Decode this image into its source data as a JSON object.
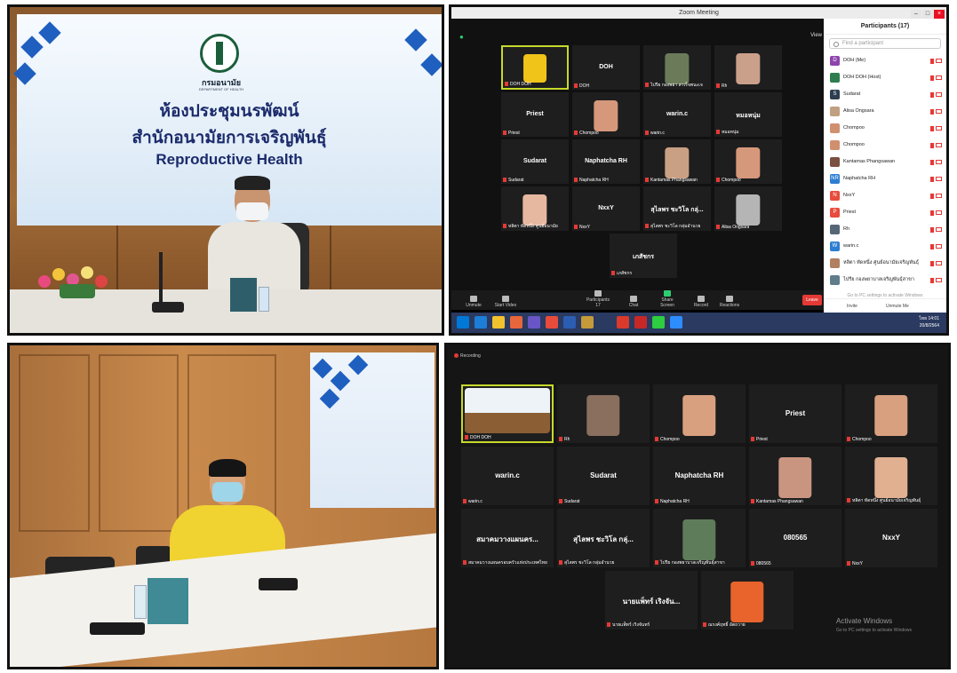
{
  "top_left": {
    "sign_dept": "กรมอนามัย",
    "sign_dept_en": "DEPARTMENT OF HEALTH",
    "sign_line1": "ห้องประชุมนรพัฒน์",
    "sign_line2": "สำนักอนามัยการเจริญพันธุ์",
    "sign_line3": "Reproductive Health"
  },
  "zoom_top": {
    "window_title": "Zoom Meeting",
    "view_label": "View",
    "participants_header": "Participants (17)",
    "find_placeholder": "Find a participant",
    "tiles": [
      {
        "name": "",
        "label": "DOH DOH"
      },
      {
        "name": "DOH",
        "label": "DOH"
      },
      {
        "name": "",
        "label": "ไปรีย กองพยา สาเร็จพนะเจ"
      },
      {
        "name": "",
        "label": "Rh"
      },
      {
        "name": "Priest",
        "label": "Priest"
      },
      {
        "name": "",
        "label": "Chompoo"
      },
      {
        "name": "warin.c",
        "label": "warin.c"
      },
      {
        "name": "หมอหนุ่ม",
        "label": "หมอหนุ่ม"
      },
      {
        "name": "Sudarat",
        "label": "Sudarat"
      },
      {
        "name": "Naphatcha RH",
        "label": "Naphatcha RH"
      },
      {
        "name": "",
        "label": "Kantamas Phangsawan"
      },
      {
        "name": "",
        "label": "Chompoo"
      },
      {
        "name": "",
        "label": "หลิตา ทัดหนึ่ง ศูนย์อนามัย"
      },
      {
        "name": "NxxY",
        "label": "NxxY"
      },
      {
        "name": "สุไลพร ชะวิโล กลุ่...",
        "label": "สุไลพร ชะวิโล กลุ่มอำนวย"
      },
      {
        "name": "",
        "label": "Alisa Ongsara"
      },
      {
        "name": "เภสัชกร",
        "label": "เภสัชกร"
      }
    ],
    "participants": [
      {
        "initial": "D",
        "color": "#8e44ad",
        "name": "DOH (Me)"
      },
      {
        "initial": "",
        "color": "#2e7d4f",
        "name": "DOH DOH (Host)"
      },
      {
        "initial": "S",
        "color": "#2c3e50",
        "name": "Sudarat"
      },
      {
        "initial": "",
        "color": "#c0a080",
        "name": "Alisa Ongsara"
      },
      {
        "initial": "",
        "color": "#d09070",
        "name": "Chompoo"
      },
      {
        "initial": "",
        "color": "#d09070",
        "name": "Chompoo"
      },
      {
        "initial": "",
        "color": "#7a5040",
        "name": "Kantamas Phangsawan"
      },
      {
        "initial": "NR",
        "color": "#2d7dd2",
        "name": "Naphatcha RH"
      },
      {
        "initial": "N",
        "color": "#e74c3c",
        "name": "NxxY"
      },
      {
        "initial": "P",
        "color": "#e74c3c",
        "name": "Priest"
      },
      {
        "initial": "",
        "color": "#556677",
        "name": "Rh"
      },
      {
        "initial": "W",
        "color": "#2d7dd2",
        "name": "warin.c"
      },
      {
        "initial": "",
        "color": "#b08060",
        "name": "หลิตา ทัดหนึ่ง ศูนย์อนามัยเจริญพันธุ์"
      },
      {
        "initial": "",
        "color": "#607d8b",
        "name": "ไปรีย กองพยาบาลเจริญพันธุ์สาขา"
      }
    ],
    "footer_invite": "Invite",
    "footer_unmute": "Unmute Me",
    "activate_text": "Go to PC settings to activate Windows",
    "toolbar": {
      "unmute": "Unmute",
      "start_video": "Start Video",
      "participants": "Participants",
      "participants_count": "17",
      "chat": "Chat",
      "share": "Share Screen",
      "record": "Record",
      "reactions": "Reactions",
      "leave": "Leave"
    },
    "clock_time": "14:01",
    "clock_date": "20/8/2564",
    "lang": "ไทย"
  },
  "zoom_bottom": {
    "recording": "Recording",
    "tiles": [
      {
        "name": "",
        "label": "DOH DOH"
      },
      {
        "name": "",
        "label": "Rh"
      },
      {
        "name": "",
        "label": "Chompoo"
      },
      {
        "name": "Priest",
        "label": "Priest"
      },
      {
        "name": "",
        "label": "Chompoo"
      },
      {
        "name": "warin.c",
        "label": "warin.c"
      },
      {
        "name": "Sudarat",
        "label": "Sudarat"
      },
      {
        "name": "Naphatcha RH",
        "label": "Naphatcha RH"
      },
      {
        "name": "",
        "label": "Kantamas Phangsawan"
      },
      {
        "name": "",
        "label": "หลิตา ทัดหนึ่ง ศูนย์อนามัยเจริญพันธุ์"
      },
      {
        "name": "สมาคมวางแผนคร...",
        "label": "สมาคมวางแผนครอบครัวแห่งประเทศไทย"
      },
      {
        "name": "สุไลพร ชะวิโล กลุ่...",
        "label": "สุไลพร ชะวิโล กลุ่มอำนวย"
      },
      {
        "name": "",
        "label": "ไปรีย กองพยาบาลเจริญพันธุ์สาขา"
      },
      {
        "name": "080565",
        "label": "080565"
      },
      {
        "name": "NxxY",
        "label": "NxxY"
      },
      {
        "name": "นายแพ็ทร์ เริงจัน...",
        "label": "นายแพ็ทร์ เริงจันทร์"
      },
      {
        "name": "",
        "label": "ณรงค์ฤทธิ์ อัตถวาย"
      }
    ],
    "activate_title": "Activate Windows",
    "activate_sub": "Go to PC settings to activate Windows"
  }
}
